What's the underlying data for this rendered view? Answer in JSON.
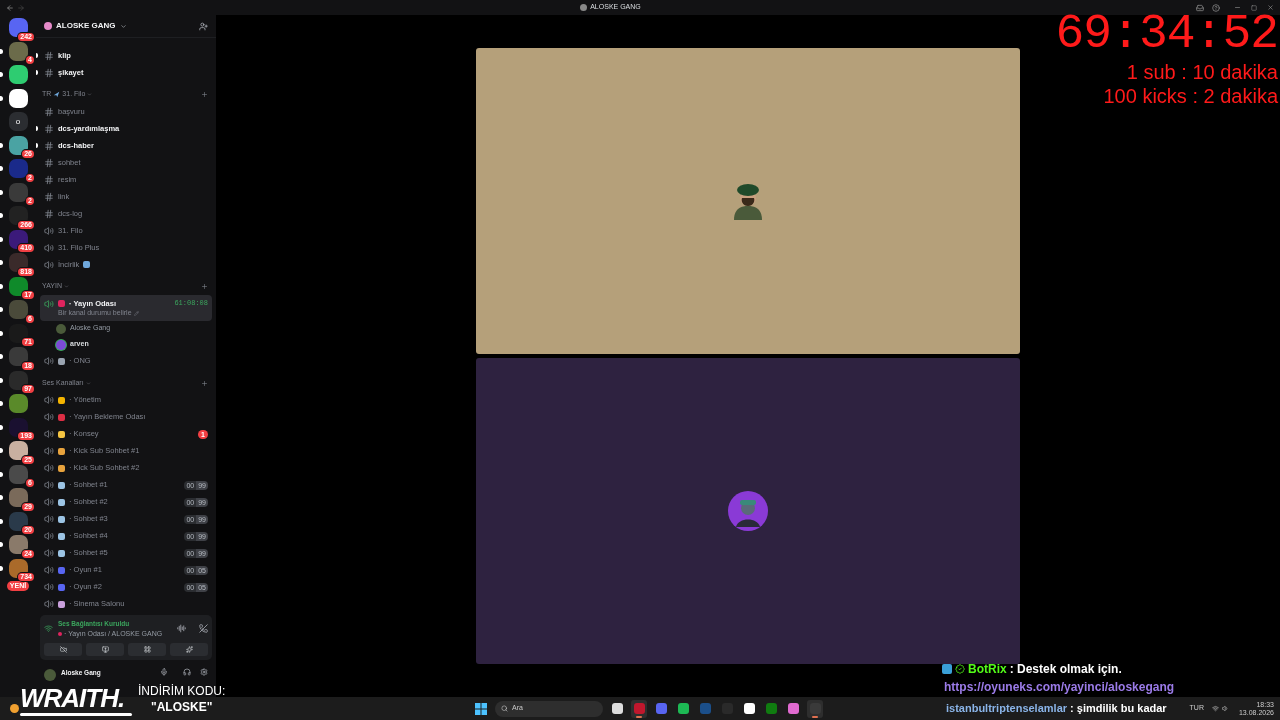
{
  "window": {
    "title": "ALOSKE GANG"
  },
  "servers": [
    {
      "badge": "242",
      "unread": false,
      "selected": false
    },
    {
      "badge": "4",
      "unread": true,
      "selected": false
    },
    {
      "unread": true,
      "selected": false
    },
    {
      "unread": true,
      "selected": false
    },
    {
      "label": "o",
      "unread": false,
      "selected": false
    },
    {
      "badge": "26",
      "unread": true,
      "selected": false
    },
    {
      "badge": "2",
      "unread": true,
      "selected": false
    },
    {
      "badge": "2",
      "unread": true,
      "selected": false
    },
    {
      "badge": "266",
      "unread": true,
      "selected": false
    },
    {
      "badge": "410",
      "unread": true,
      "selected": false
    },
    {
      "badge": "818",
      "unread": true,
      "selected": false
    },
    {
      "badge": "17",
      "unread": true,
      "selected": false
    },
    {
      "badge": "6",
      "unread": true,
      "selected": false
    },
    {
      "badge": "71",
      "unread": true,
      "selected": false
    },
    {
      "badge": "18",
      "unread": true,
      "selected": false
    },
    {
      "badge": "97",
      "unread": true,
      "selected": false
    },
    {
      "unread": true,
      "selected": false
    },
    {
      "badge": "193",
      "unread": true,
      "selected": false
    },
    {
      "badge": "25",
      "unread": true,
      "selected": false
    },
    {
      "badge": "6",
      "unread": true,
      "selected": false
    },
    {
      "badge": "29",
      "unread": true,
      "selected": false
    },
    {
      "badge": "20",
      "unread": true,
      "selected": false
    },
    {
      "badge": "24",
      "unread": true,
      "selected": false
    },
    {
      "badge": "734",
      "unread": true,
      "selected": false
    }
  ],
  "new_button": "YENİ",
  "server_header": {
    "name": "ALOSKE GANG"
  },
  "channel_groups": [
    {
      "channels": [
        {
          "kind": "text",
          "name": "klip",
          "unread": true,
          "selected": false
        },
        {
          "kind": "text",
          "name": "şikayet",
          "unread": true,
          "selected": false
        }
      ]
    },
    {
      "category": "31. Filo",
      "prefix": "TR",
      "channels": [
        {
          "kind": "text",
          "name": "başvuru",
          "unread": false,
          "selected": false
        },
        {
          "kind": "text",
          "name": "dcs-yardımlaşma",
          "unread": true,
          "selected": false
        },
        {
          "kind": "text",
          "name": "dcs-haber",
          "unread": true,
          "selected": false
        },
        {
          "kind": "text",
          "name": "sohbet",
          "unread": false,
          "selected": false
        },
        {
          "kind": "text",
          "name": "resim",
          "unread": false,
          "selected": false
        },
        {
          "kind": "text",
          "name": "link",
          "unread": false,
          "selected": false
        },
        {
          "kind": "text",
          "name": "dcs-log",
          "unread": false,
          "selected": false
        },
        {
          "kind": "voice",
          "name": "31. Filo",
          "unread": false,
          "selected": false
        },
        {
          "kind": "voice",
          "name": "31. Filo Plus",
          "unread": false,
          "selected": false
        },
        {
          "kind": "voice",
          "name": "İncirlik",
          "unread": false,
          "selected": false,
          "color": "#6fa8dc"
        }
      ]
    },
    {
      "category": "YAYIN",
      "channels": [
        {
          "kind": "voice",
          "name": "· Yayın Odası",
          "unread": true,
          "selected": true,
          "color": "#e0245e",
          "timer": "61:08:08",
          "status": "Bir kanal durumu belirle",
          "members": [
            {
              "name": "Aloske Gang",
              "speaking": false
            },
            {
              "name": "arven",
              "speaking": true
            }
          ]
        },
        {
          "kind": "voice",
          "name": "· ONG",
          "unread": false,
          "selected": false,
          "color": "#9aa4b1"
        }
      ]
    },
    {
      "category": "Ses Kanalları",
      "channels": [
        {
          "kind": "voice",
          "name": "· Yönetim",
          "unread": false,
          "selected": false,
          "color": "#f4b400"
        },
        {
          "kind": "voice",
          "name": "· Yayın Bekleme Odası",
          "unread": false,
          "selected": false,
          "color": "#dd2e44"
        },
        {
          "kind": "voice",
          "name": "· Konsey",
          "unread": false,
          "selected": false,
          "color": "#f5c542",
          "mentions": "1"
        },
        {
          "kind": "voice",
          "name": "· Kick Sub Sohbet #1",
          "unread": false,
          "selected": false,
          "color": "#e8a33d"
        },
        {
          "kind": "voice",
          "name": "· Kick Sub Sohbet #2",
          "unread": false,
          "selected": false,
          "color": "#e8a33d"
        },
        {
          "kind": "voice",
          "name": "· Sohbet #1",
          "unread": false,
          "selected": false,
          "color": "#9cc4e4",
          "count": "00",
          "limit": "99"
        },
        {
          "kind": "voice",
          "name": "· Sohbet #2",
          "unread": false,
          "selected": false,
          "color": "#9cc4e4",
          "count": "00",
          "limit": "99"
        },
        {
          "kind": "voice",
          "name": "· Sohbet #3",
          "unread": false,
          "selected": false,
          "color": "#9cc4e4",
          "count": "00",
          "limit": "99"
        },
        {
          "kind": "voice",
          "name": "· Sohbet #4",
          "unread": false,
          "selected": false,
          "color": "#9cc4e4",
          "count": "00",
          "limit": "99"
        },
        {
          "kind": "voice",
          "name": "· Sohbet #5",
          "unread": false,
          "selected": false,
          "color": "#9cc4e4",
          "count": "00",
          "limit": "99"
        },
        {
          "kind": "voice",
          "name": "· Oyun #1",
          "unread": false,
          "selected": false,
          "color": "#5865f2",
          "count": "00",
          "limit": "05"
        },
        {
          "kind": "voice",
          "name": "· Oyun #2",
          "unread": false,
          "selected": false,
          "color": "#5865f2",
          "count": "00",
          "limit": "05"
        },
        {
          "kind": "voice",
          "name": "· Sinema Salonu",
          "unread": false,
          "selected": false,
          "color": "#c9a0dc"
        }
      ]
    }
  ],
  "voice_panel": {
    "title": "Ses Bağlantısı Kuruldu",
    "location": "· Yayın Odası / ALOSKE GANG"
  },
  "user_panel": {
    "name": "Aloske Gang"
  },
  "video_tiles": [
    {
      "kind": "turban"
    },
    {
      "kind": "purple"
    }
  ],
  "timer": {
    "time": "69:34:52",
    "rules": [
      "1 sub : 10 dakika",
      "100 kicks : 2 dakika"
    ]
  },
  "chat": [
    {
      "kind": "bot",
      "user": "BotRix",
      "text": ": Destek olmak için."
    },
    {
      "kind": "link",
      "text": "https://oyuneks.com/yayinci/aloskegang"
    },
    {
      "kind": "message",
      "user": "istanbultriptenselamlar",
      "text": ": şimdilik bu kadar"
    }
  ],
  "sponsor": {
    "brand": "WRAITH.",
    "code_label": "İNDİRİM KODU:",
    "code": "\"ALOSKE\""
  },
  "taskbar": {
    "search_placeholder": "Ara",
    "apps": [
      {
        "kind": "taskview",
        "selected": false
      },
      {
        "kind": "opera",
        "selected": true
      },
      {
        "kind": "discord",
        "selected": false
      },
      {
        "kind": "spotify",
        "selected": false
      },
      {
        "kind": "steam",
        "selected": false
      },
      {
        "kind": "epic",
        "selected": false
      },
      {
        "kind": "capcut",
        "selected": false
      },
      {
        "kind": "xbox",
        "selected": false
      },
      {
        "kind": "copilot",
        "selected": false
      },
      {
        "kind": "obs",
        "selected": true
      }
    ],
    "language": "TUR",
    "time": "18:33",
    "date": "13.08.2026"
  }
}
